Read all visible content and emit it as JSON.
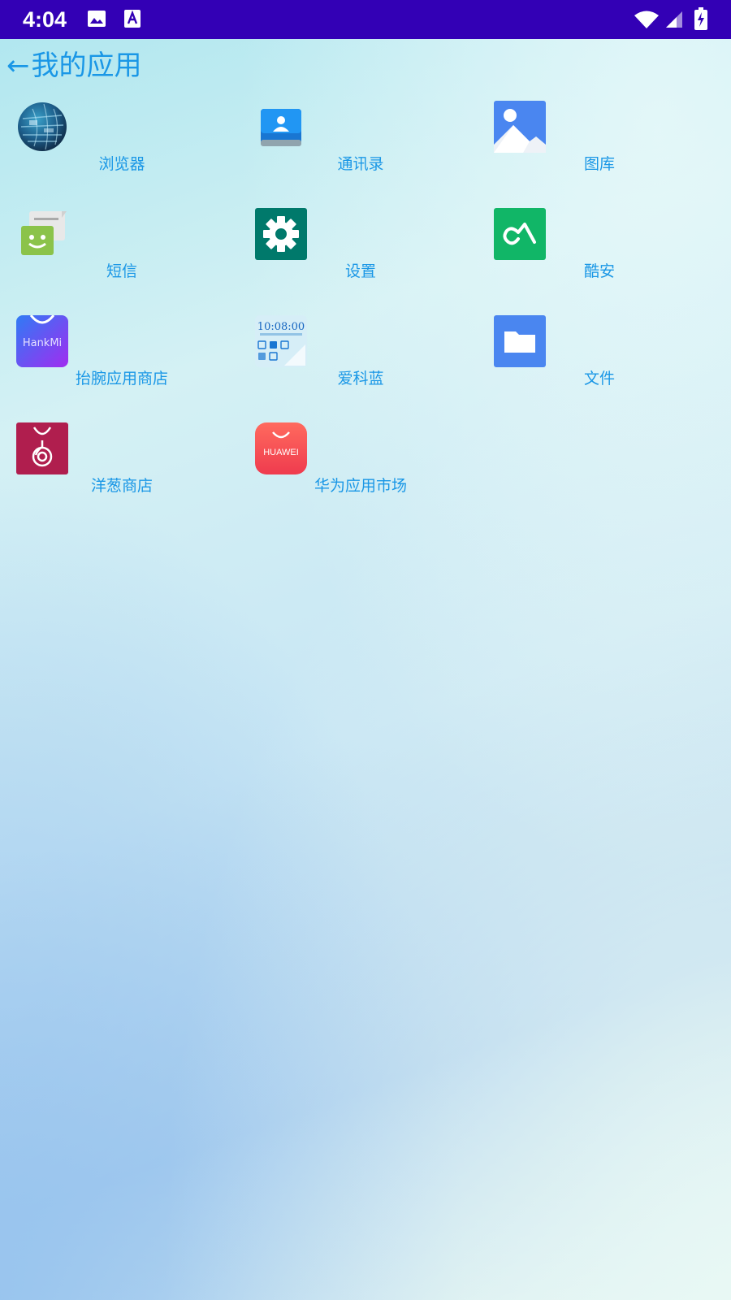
{
  "status_bar": {
    "time": "4:04",
    "icons": [
      "image-icon",
      "font-a-icon",
      "wifi-icon",
      "cell-signal-icon",
      "battery-charging-icon"
    ]
  },
  "header": {
    "back_arrow": "←",
    "title": "我的应用"
  },
  "apps": [
    {
      "label": "浏览器",
      "icon": "browser-globe-icon"
    },
    {
      "label": "通讯录",
      "icon": "contacts-icon"
    },
    {
      "label": "图库",
      "icon": "gallery-icon"
    },
    {
      "label": "短信",
      "icon": "messaging-icon"
    },
    {
      "label": "设置",
      "icon": "settings-gear-icon"
    },
    {
      "label": "酷安",
      "icon": "coolapk-icon"
    },
    {
      "label": "抬腕应用商店",
      "icon": "hankmi-store-icon",
      "icon_text": "HankMi"
    },
    {
      "label": "爱科蓝",
      "icon": "watchface-icon",
      "icon_text": "10:08:00"
    },
    {
      "label": "文件",
      "icon": "files-folder-icon"
    },
    {
      "label": "洋葱商店",
      "icon": "onion-store-icon"
    },
    {
      "label": "华为应用市场",
      "icon": "huawei-appgallery-icon",
      "icon_text": "HUAWEI"
    }
  ],
  "colors": {
    "status_bar": "#3300b5",
    "accent_text": "#1a97e6"
  }
}
